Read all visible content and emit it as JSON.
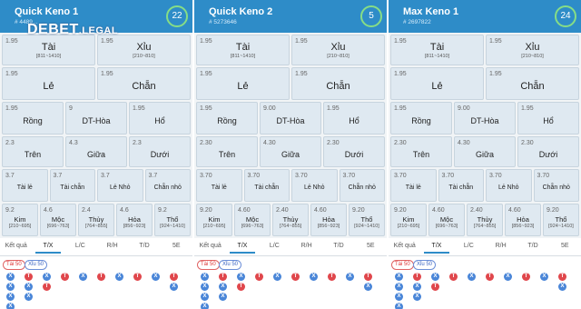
{
  "watermark": {
    "brand": "DEBET",
    "suffix": ".LEGAL"
  },
  "panels": [
    {
      "title": "Quick Keno 1",
      "id": "# 4489...",
      "count": "22"
    },
    {
      "title": "Quick Keno 2",
      "id": "# 5273646",
      "count": "5"
    },
    {
      "title": "Max Keno 1",
      "id": "# 2697822",
      "count": "24"
    }
  ],
  "rows": [
    [
      [
        {
          "odds": "1.95",
          "label": "Tài",
          "range": "[811~1410]"
        },
        {
          "odds": "1.95",
          "label": "Xỉu",
          "range": "[210~810]"
        }
      ],
      [
        {
          "odds": "1.95",
          "label": "Tài",
          "range": "[811~1410]"
        },
        {
          "odds": "1.95",
          "label": "Xỉu",
          "range": "[210~810]"
        }
      ],
      [
        {
          "odds": "1.95",
          "label": "Tài",
          "range": "[811~1410]"
        },
        {
          "odds": "1.95",
          "label": "Xỉu",
          "range": "[210~810]"
        }
      ]
    ],
    [
      [
        {
          "odds": "1.95",
          "label": "Lẻ"
        },
        {
          "odds": "1.95",
          "label": "Chẵn"
        }
      ],
      [
        {
          "odds": "1.95",
          "label": "Lẻ"
        },
        {
          "odds": "1.95",
          "label": "Chẵn"
        }
      ],
      [
        {
          "odds": "1.95",
          "label": "Lẻ"
        },
        {
          "odds": "1.95",
          "label": "Chẵn"
        }
      ]
    ],
    [
      [
        {
          "odds": "1.95",
          "label": "Rồng"
        },
        {
          "odds": "9",
          "label": "DT-Hòa"
        },
        {
          "odds": "1.95",
          "label": "Hổ"
        }
      ],
      [
        {
          "odds": "1.95",
          "label": "Rồng"
        },
        {
          "odds": "9.00",
          "label": "DT-Hòa"
        },
        {
          "odds": "1.95",
          "label": "Hổ"
        }
      ],
      [
        {
          "odds": "1.95",
          "label": "Rồng"
        },
        {
          "odds": "9.00",
          "label": "DT-Hòa"
        },
        {
          "odds": "1.95",
          "label": "Hổ"
        }
      ]
    ],
    [
      [
        {
          "odds": "2.3",
          "label": "Trên"
        },
        {
          "odds": "4.3",
          "label": "Giữa"
        },
        {
          "odds": "2.3",
          "label": "Dưới"
        }
      ],
      [
        {
          "odds": "2.30",
          "label": "Trên"
        },
        {
          "odds": "4.30",
          "label": "Giữa"
        },
        {
          "odds": "2.30",
          "label": "Dưới"
        }
      ],
      [
        {
          "odds": "2.30",
          "label": "Trên"
        },
        {
          "odds": "4.30",
          "label": "Giữa"
        },
        {
          "odds": "2.30",
          "label": "Dưới"
        }
      ]
    ],
    [
      [
        {
          "odds": "3.7",
          "label": "Tài lẻ"
        },
        {
          "odds": "3.7",
          "label": "Tài chẵn"
        },
        {
          "odds": "3.7",
          "label": "Lẻ Nhỏ"
        },
        {
          "odds": "3.7",
          "label": "Chẵn nhỏ"
        }
      ],
      [
        {
          "odds": "3.70",
          "label": "Tài lẻ"
        },
        {
          "odds": "3.70",
          "label": "Tài chẵn"
        },
        {
          "odds": "3.70",
          "label": "Lẻ Nhỏ"
        },
        {
          "odds": "3.70",
          "label": "Chẵn nhỏ"
        }
      ],
      [
        {
          "odds": "3.70",
          "label": "Tài lẻ"
        },
        {
          "odds": "3.70",
          "label": "Tài chẵn"
        },
        {
          "odds": "3.70",
          "label": "Lẻ Nhỏ"
        },
        {
          "odds": "3.70",
          "label": "Chẵn nhỏ"
        }
      ]
    ],
    [
      [
        {
          "odds": "9.2",
          "label": "Kim",
          "range": "[210~695]"
        },
        {
          "odds": "4.6",
          "label": "Mộc",
          "range": "[696~763]"
        },
        {
          "odds": "2.4",
          "label": "Thủy",
          "range": "[764~855]"
        },
        {
          "odds": "4.6",
          "label": "Hỏa",
          "range": "[856~923]"
        },
        {
          "odds": "9.2",
          "label": "Thổ",
          "range": "[924~1410]"
        }
      ],
      [
        {
          "odds": "9.20",
          "label": "Kim",
          "range": "[210~695]"
        },
        {
          "odds": "4.60",
          "label": "Mộc",
          "range": "[696~763]"
        },
        {
          "odds": "2.40",
          "label": "Thủy",
          "range": "[764~855]"
        },
        {
          "odds": "4.60",
          "label": "Hỏa",
          "range": "[856~923]"
        },
        {
          "odds": "9.20",
          "label": "Thổ",
          "range": "[924~1410]"
        }
      ],
      [
        {
          "odds": "9.20",
          "label": "Kim",
          "range": "[210~695]"
        },
        {
          "odds": "4.60",
          "label": "Mộc",
          "range": "[696~763]"
        },
        {
          "odds": "2.40",
          "label": "Thủy",
          "range": "[764~855]"
        },
        {
          "odds": "4.60",
          "label": "Hỏa",
          "range": "[856~923]"
        },
        {
          "odds": "9.20",
          "label": "Thổ",
          "range": "[924~1410]"
        }
      ]
    ]
  ],
  "tabs": [
    "Kết quả",
    "T/X",
    "L/C",
    "R/H",
    "T/D",
    "5E"
  ],
  "active_tab": "T/X",
  "pills": {
    "tai": "Tài 50",
    "xiu": "Xỉu 50"
  },
  "result_columns": [
    [
      "X",
      "X",
      "X",
      "X"
    ],
    [
      "T",
      "X",
      "X"
    ],
    [
      "X",
      "T"
    ],
    [
      "T"
    ],
    [
      "X"
    ],
    [
      "T"
    ],
    [
      "X"
    ],
    [
      "T"
    ],
    [
      "X"
    ],
    [
      "T",
      "X"
    ]
  ],
  "colors": {
    "header": "#2e8cc8",
    "tai": "#e0474c",
    "xiu": "#4a86d8",
    "counter_ring": "#86dd86"
  },
  "icons": {
    "count_ring": "circle-countdown-icon",
    "result_marker": "result-dot-icon"
  }
}
